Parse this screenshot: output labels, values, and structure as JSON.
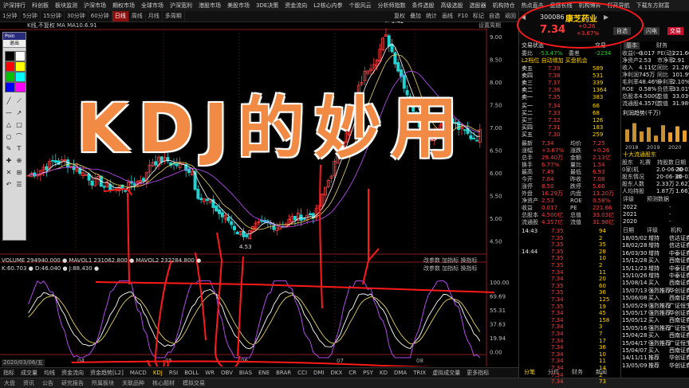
{
  "top_menu": [
    "沪深排行",
    "科创板",
    "板块监测",
    "沪深市场",
    "期权市场",
    "全球市场",
    "沪深宽利",
    "港股市场",
    "美股市场",
    "3DE决策",
    "资金流向",
    "L2核心内参",
    "个股风云",
    "分析师指数",
    "条件选股",
    "高级选股",
    "选股器",
    "机构持仓",
    "热点直击",
    "盘感长线",
    "机构博弈",
    "打开导航",
    "下载东方财富"
  ],
  "timeframes": [
    "1分钟",
    "5分钟",
    "15分钟",
    "30分钟",
    "60分钟",
    "日线",
    "周线",
    "月线",
    "多周期"
  ],
  "active_timeframe": "日线",
  "toolbar_right": [
    "复权",
    "叠加",
    "统计",
    "画线",
    "F10",
    "标记",
    "自选",
    "返回"
  ],
  "chart": {
    "info_line": "K线,不复权 MA MA10.6.91",
    "right_label": "设置周期",
    "price_ticks": [
      "9.00",
      "8.50",
      "8.00",
      "7.50",
      "7.00",
      "6.50",
      "6.00",
      "5.50",
      "5.00",
      "4.50"
    ],
    "high_label": "9.42",
    "low_label": "4.53",
    "volume_line": "VOLUME 294940.000 ● MAVOL1 231062.800 ● MAVOL2 232284.800 ●",
    "kdj_line": "K:60.703 ● D:46.040 ● J:88.430 ●",
    "panel_tabs": [
      "改参数",
      "加指标",
      "换指标"
    ],
    "kdj_ticks": [
      "100.00",
      "69.69",
      "55.31",
      "37.63",
      "19.94",
      "0.00"
    ],
    "date_label": "2020/03/06/五",
    "month_labels": [
      "04",
      "05",
      "06",
      "07",
      "08"
    ]
  },
  "toolbox": {
    "title": "Poin",
    "close": "退出"
  },
  "overlay_title": "KDJ的妙用",
  "bottom_tabs": [
    "指标",
    "成交量",
    "均线",
    "资金流向",
    "资金趋势[L2]",
    "MACD",
    "KDJ",
    "RSI",
    "BOLL",
    "WR",
    "OBV",
    "BIAS",
    "ENE",
    "BRAR",
    "CCI",
    "DMI",
    "DKX",
    "CR",
    "PSY",
    "KD",
    "DMA",
    "TRIX",
    "虚拟成交量",
    "更多指标"
  ],
  "active_bottom_tab": "KDJ",
  "status_bar": [
    "大盘",
    "资讯",
    "公告",
    "研究报告",
    "所属板块",
    "关联品种",
    "核心题材",
    "模拟交易"
  ],
  "stock": {
    "code": "300086",
    "name": "康芝药业",
    "price": "7.34",
    "change": "+0.26",
    "change_pct": "+3.67%",
    "buttons": [
      "自选",
      "闪电",
      "交易"
    ],
    "section": "交易状态",
    "section_right": "交易"
  },
  "stats_top": [
    {
      "label": "委比",
      "value": "-53.47%",
      "label2": "委差",
      "value2": "-2234"
    }
  ],
  "order_book_title": "L2档位 自动增加 买盘机会",
  "asks": [
    {
      "level": "卖五",
      "price": "7.39",
      "vol": "589"
    },
    {
      "level": "卖四",
      "price": "7.38",
      "vol": "531"
    },
    {
      "level": "卖三",
      "price": "7.37",
      "vol": "339"
    },
    {
      "level": "卖二",
      "price": "7.36",
      "vol": "1364"
    },
    {
      "level": "卖一",
      "price": "7.35",
      "vol": "383"
    }
  ],
  "bids": [
    {
      "level": "买一",
      "price": "7.34",
      "vol": "66"
    },
    {
      "level": "买二",
      "price": "7.33",
      "vol": "68"
    },
    {
      "level": "买三",
      "price": "7.32",
      "vol": "126"
    },
    {
      "level": "买四",
      "price": "7.31",
      "vol": "183"
    },
    {
      "level": "买五",
      "price": "7.30",
      "vol": "259"
    }
  ],
  "quote_stats": [
    {
      "l": "最新",
      "v": "7.34",
      "l2": "均价",
      "v2": "7.25"
    },
    {
      "l": "涨幅",
      "v": "+3.67%",
      "l2": "涨跌",
      "v2": "+0.26"
    },
    {
      "l": "总手",
      "v": "29.40万",
      "l2": "金额",
      "v2": "2.13亿"
    },
    {
      "l": "换手",
      "v": "6.77%",
      "l2": "量比",
      "v2": "1.54"
    },
    {
      "l": "最高",
      "v": "7.49",
      "l2": "最低",
      "v2": "6.93"
    },
    {
      "l": "今开",
      "v": "7.04",
      "l2": "昨收",
      "v2": "7.08"
    },
    {
      "l": "涨停",
      "v": "8.50",
      "l2": "跌停",
      "v2": "5.66"
    },
    {
      "l": "外盘",
      "v": "16.29万",
      "l2": "内盘",
      "v2": "13.20万"
    },
    {
      "l": "净资产",
      "v": "2.53",
      "l2": "ROE",
      "v2": "0.58%"
    },
    {
      "l": "收益",
      "v": "0.017",
      "l2": "PE",
      "v2": "221.66"
    },
    {
      "l": "总股本",
      "v": "4.500亿",
      "l2": "总值",
      "v2": "33.03亿"
    },
    {
      "l": "流通股",
      "v": "4.357亿",
      "l2": "流值",
      "v2": "31.98亿"
    }
  ],
  "ticks": [
    {
      "t": "14:43",
      "p": "7.35",
      "v": "94"
    },
    {
      "t": "",
      "p": "7.35",
      "v": "2"
    },
    {
      "t": "",
      "p": "7.35",
      "v": "35"
    },
    {
      "t": "14:44",
      "p": "7.35",
      "v": "28"
    },
    {
      "t": "",
      "p": "7.35",
      "v": "10"
    },
    {
      "t": "",
      "p": "7.35",
      "v": "2"
    },
    {
      "t": "",
      "p": "7.34",
      "v": "11"
    },
    {
      "t": "",
      "p": "7.34",
      "v": "20"
    },
    {
      "t": "",
      "p": "7.35",
      "v": "60"
    },
    {
      "t": "",
      "p": "7.35",
      "v": "36"
    },
    {
      "t": "",
      "p": "7.34",
      "v": "125"
    },
    {
      "t": "",
      "p": "7.35",
      "v": "19"
    },
    {
      "t": "",
      "p": "7.34",
      "v": "45"
    },
    {
      "t": "",
      "p": "7.34",
      "v": "158"
    },
    {
      "t": "",
      "p": "7.34",
      "v": "3"
    },
    {
      "t": "",
      "p": "7.34",
      "v": "7"
    },
    {
      "t": "",
      "p": "7.34",
      "v": "17"
    },
    {
      "t": "",
      "p": "7.34",
      "v": "36"
    },
    {
      "t": "",
      "p": "7.34",
      "v": "10"
    },
    {
      "t": "",
      "p": "7.34",
      "v": "11"
    },
    {
      "t": "",
      "p": "7.34",
      "v": "14"
    },
    {
      "t": "",
      "p": "7.34",
      "v": "2"
    },
    {
      "t": "",
      "p": "7.34",
      "v": "73"
    }
  ],
  "f10": {
    "tabs": [
      "基本",
      "财务"
    ],
    "rows": [
      {
        "l": "收益(一)",
        "v": "0.017",
        "l2": "PE(动)",
        "v2": "221.66"
      },
      {
        "l": "净资产",
        "v": "2.53",
        "l2": "市净率",
        "v2": "2.91"
      },
      {
        "l": "收入",
        "v": "4.11亿",
        "l2": "同比",
        "v2": "21.26%"
      },
      {
        "l": "净利润",
        "v": "745万",
        "l2": "同比",
        "v2": "101.9%"
      },
      {
        "l": "毛利率",
        "v": "48.46%",
        "l2": "净利率",
        "v2": "2.10%"
      },
      {
        "l": "ROE",
        "v": "0.58%",
        "l2": "负债率",
        "v2": "33.01%"
      },
      {
        "l": "总股本",
        "v": "4.500亿",
        "l2": "总值",
        "v2": "33.03亿"
      },
      {
        "l": "流通股",
        "v": "4.357亿",
        "l2": "流值",
        "v2": "31.98亿"
      }
    ],
    "profit_title": "利润趋势(千万)",
    "years": [
      "2018",
      "2019",
      "2020"
    ],
    "holder_tabs": [
      "十大流通股东"
    ],
    "holder_cols": [
      "股东",
      "礼赛",
      "持股数",
      "日期"
    ],
    "holders": [
      {
        "a": "0家(机",
        "b": "0家(机",
        "c": "2.0-06-30",
        "d": "20-03-31"
      },
      {
        "a": "股东情况",
        "b": "",
        "c": "20-06-30",
        "d": "20-03-31"
      },
      {
        "a": "股东人数",
        "b": "",
        "c": "2.33万",
        "d": "2.62万"
      },
      {
        "a": "人均持股",
        "b": "",
        "c": "1.87万",
        "d": "1.66万"
      }
    ],
    "rating_tabs": [
      "评级",
      "预测数据"
    ],
    "rating_rows": [
      {
        "y": "2022",
        "v": "-"
      },
      {
        "y": "2021",
        "v": "-"
      },
      {
        "y": "2020",
        "v": "-"
      }
    ],
    "research_cols": [
      "日期",
      "评级",
      "机构"
    ],
    "research": [
      {
        "d": "18/05/02",
        "r": "增持",
        "i": "信达证券"
      },
      {
        "d": "18/02/28",
        "r": "增持",
        "i": "信达证券"
      },
      {
        "d": "16/03/30",
        "r": "增持",
        "i": "中泰证券"
      },
      {
        "d": "15/12/28",
        "r": "买入",
        "i": "西南证券"
      },
      {
        "d": "15/11/23",
        "r": "增持",
        "i": "中泰证券"
      },
      {
        "d": "15/10/26",
        "r": "增持",
        "i": "中泰证券"
      },
      {
        "d": "15/08/14",
        "r": "买入",
        "i": "西南证券"
      },
      {
        "d": "15/07/13",
        "r": "强烈推荐",
        "i": "华创证券"
      },
      {
        "d": "15/06/08",
        "r": "买入",
        "i": "西南证券"
      },
      {
        "d": "15/05/29",
        "r": "强烈推荐",
        "i": "广证恒生"
      },
      {
        "d": "15/05/17",
        "r": "强烈推荐",
        "i": "华创证券"
      },
      {
        "d": "15/05/12",
        "r": "买入",
        "i": "西南证券"
      },
      {
        "d": "15/05/16",
        "r": "强烈推荐",
        "i": "广证恒生"
      },
      {
        "d": "15/04/28",
        "r": "买入",
        "i": "西南证券"
      },
      {
        "d": "15/04/17",
        "r": "强烈推荐",
        "i": "广证恒生"
      },
      {
        "d": "15/04/07",
        "r": "买入",
        "i": "西南证券"
      },
      {
        "d": "14/11/11",
        "r": "推荐",
        "i": "华创证券"
      },
      {
        "d": "13/05/09",
        "r": "推荐",
        "i": "华创证券"
      }
    ]
  },
  "side_tabs": [
    "分笔",
    "分价",
    "财务",
    "新闻"
  ],
  "colors": {
    "up": "#ff3b3b",
    "down": "#22d2d2",
    "annotation": "#ff1a1a",
    "overlay": "#f08a45",
    "k_line": "#ffffff",
    "d_line": "#e8d35a",
    "j_line": "#c050ff"
  }
}
